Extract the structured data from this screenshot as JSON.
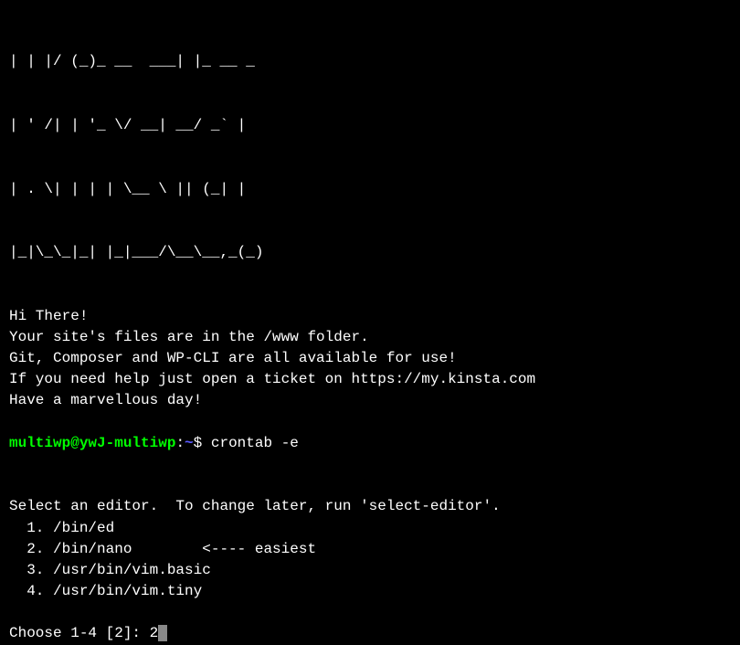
{
  "ascii": {
    "line1": "| | |/ (_)_ __  ___| |_ __ _",
    "line2": "| ' /| | '_ \\/ __| __/ _` |",
    "line3": "| . \\| | | | \\__ \\ || (_| |",
    "line4": "|_|\\_\\_|_| |_|___/\\__\\__,_(_)"
  },
  "motd": {
    "greeting": "Hi There!",
    "files": "Your site's files are in the /www folder.",
    "tools": "Git, Composer and WP-CLI are all available for use!",
    "help": "If you need help just open a ticket on https://my.kinsta.com",
    "closing": "Have a marvellous day!"
  },
  "prompt": {
    "user_host": "multiwp@ywJ-multiwp",
    "separator": ":",
    "tilde": "~",
    "symbol": "$",
    "command": "crontab -e"
  },
  "editor": {
    "header": "Select an editor.  To change later, run 'select-editor'.",
    "option1": "  1. /bin/ed",
    "option2": "  2. /bin/nano        <---- easiest",
    "option3": "  3. /usr/bin/vim.basic",
    "option4": "  4. /usr/bin/vim.tiny",
    "choose_prompt": "Choose 1-4 [2]: ",
    "input_value": "2"
  }
}
